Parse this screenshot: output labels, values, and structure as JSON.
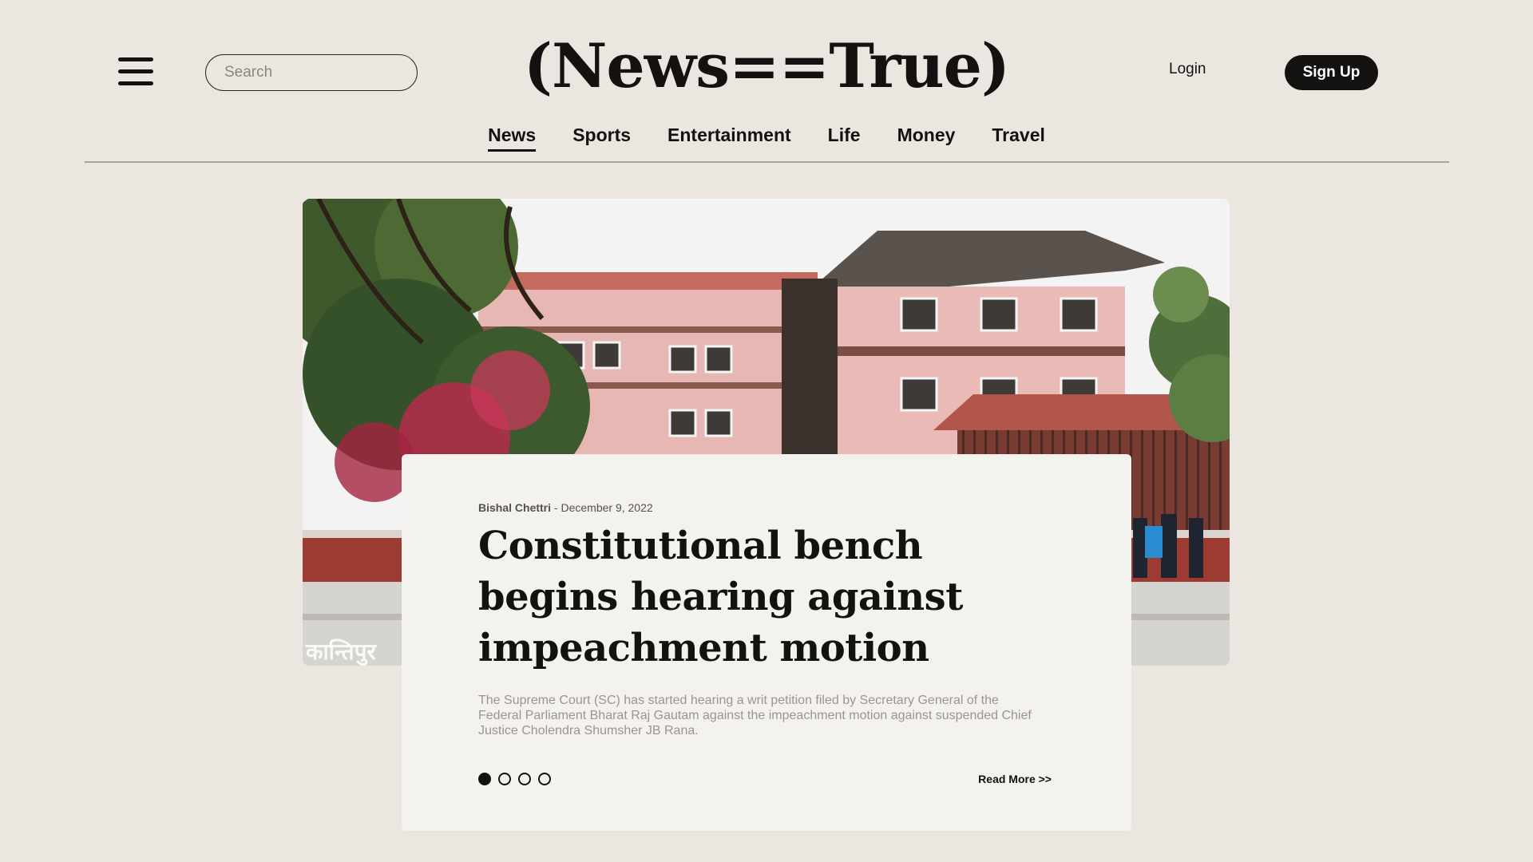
{
  "header": {
    "menu_icon": "hamburger-icon",
    "search": {
      "placeholder": "Search",
      "value": "",
      "icon": "search-icon"
    },
    "logo": "(News==True)",
    "login_label": "Login",
    "signup_label": "Sign Up"
  },
  "nav": {
    "items": [
      {
        "label": "News",
        "active": true
      },
      {
        "label": "Sports",
        "active": false
      },
      {
        "label": "Entertainment",
        "active": false
      },
      {
        "label": "Life",
        "active": false
      },
      {
        "label": "Money",
        "active": false
      },
      {
        "label": "Travel",
        "active": false
      }
    ]
  },
  "featured": {
    "image_watermark": "कान्तिपुर",
    "author": "Bishal Chettri",
    "separator": " - ",
    "date": "December 9, 2022",
    "headline": "Constitutional bench begins hearing against impeachment motion",
    "summary": "The Supreme Court (SC) has started hearing a writ petition filed by Secretary General of the Federal Parliament Bharat Raj Gautam against the impeachment motion against suspended Chief Justice Cholendra Shumsher JB Rana.",
    "read_more": "Read More >>",
    "slides": {
      "count": 4,
      "active_index": 0
    }
  },
  "colors": {
    "background": "#ebe6e0",
    "card": "#f4f2ef",
    "text": "#141210",
    "muted": "#9a958f",
    "button": "#141210"
  }
}
